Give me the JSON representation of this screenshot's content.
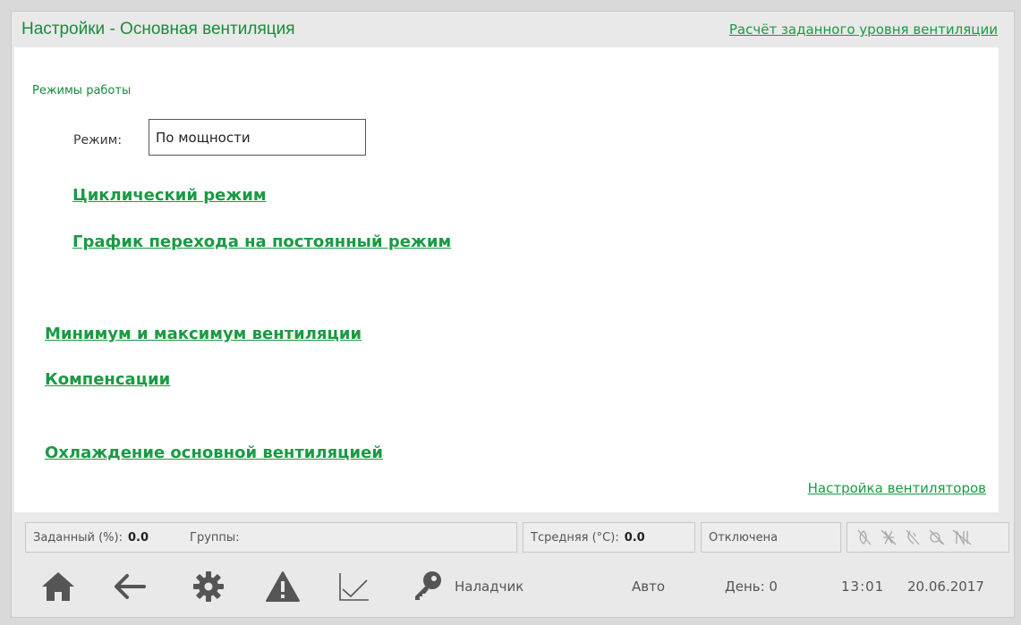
{
  "header": {
    "title": "Настройки - Основная вентиляция",
    "top_link": "Расчёт заданного уровня вентиляции"
  },
  "panel": {
    "section_label": "Режимы работы",
    "mode": {
      "label": "Режим:",
      "value": "По мощности"
    },
    "links": {
      "cyclic": "Циклический режим",
      "schedule": "График перехода на постоянный режим",
      "minmax": "Минимум и максимум вентиляции",
      "compensation": "Компенсации",
      "cooling": "Охлаждение основной вентиляцией"
    },
    "fan_setup": "Настройка вентиляторов"
  },
  "status": {
    "setpoint_label": "Заданный (%):",
    "setpoint_value": "0.0",
    "groups_label": "Группы:",
    "tavg_label": "Tсредняя (°C):",
    "tavg_value": "0.0",
    "state": "Отключена",
    "indicators": "ꝏ ⛒ ꝏ ꝏ ⛒"
  },
  "toolbar": {
    "user": "Наладчик",
    "mode": "Авто",
    "day": "День: 0",
    "time": "13:01",
    "date": "20.06.2017"
  },
  "colors": {
    "accent": "#1a9a44",
    "icon": "#555555",
    "background": "#e9e9e9"
  },
  "icons": [
    "home-icon",
    "back-arrow-icon",
    "gear-icon",
    "warning-icon",
    "chart-icon",
    "key-icon"
  ]
}
